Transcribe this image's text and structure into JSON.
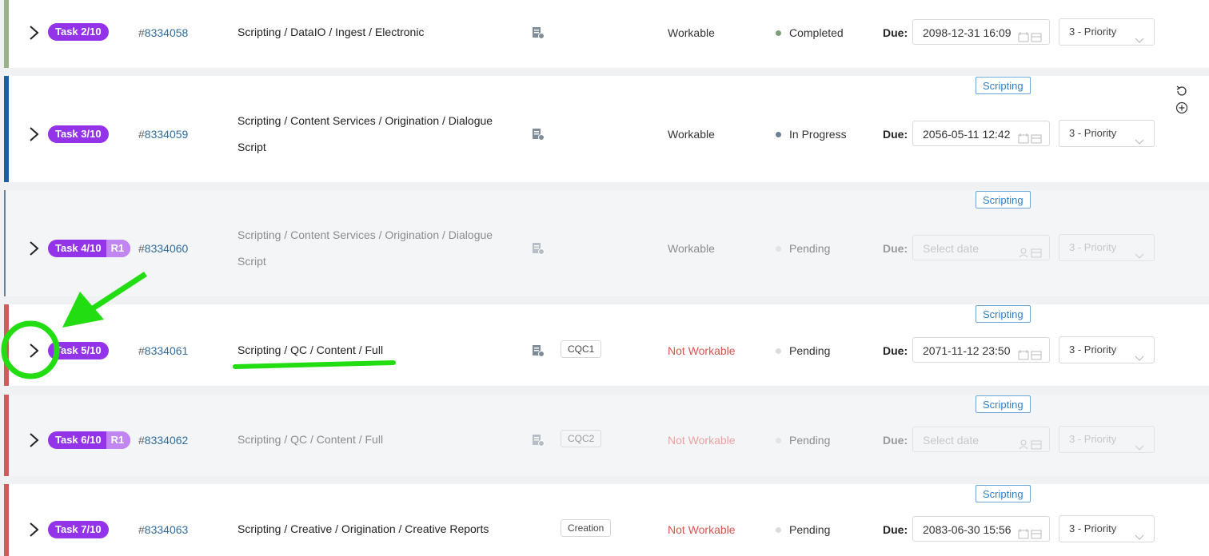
{
  "due_label": "Due:",
  "tag_label": "Scripting",
  "rows": [
    {
      "task": "Task 2/10",
      "r1": "",
      "hash": "#",
      "id": "8334058",
      "path": "Scripting / DataIO / Ingest / Electronic",
      "chip": "",
      "status": "Workable",
      "progress": "Completed",
      "due": "2098-12-31 16:09",
      "priority": "3 - Priority",
      "bar_color": "#9bb38a",
      "dot_color": "#7aa07a"
    },
    {
      "task": "Task 3/10",
      "r1": "",
      "hash": "#",
      "id": "8334059",
      "path": "Scripting / Content Services / Origination / Dialogue Script",
      "chip": "",
      "status": "Workable",
      "progress": "In Progress",
      "due": "2056-05-11 12:42",
      "priority": "3 - Priority",
      "bar_color": "#1d5fa3",
      "dot_color": "#6b7f95"
    },
    {
      "task": "Task 4/10",
      "r1": "R1",
      "hash": "#",
      "id": "8334060",
      "path": "Scripting / Content Services / Origination / Dialogue Script",
      "chip": "",
      "status": "Workable",
      "progress": "Pending",
      "due": "Select date",
      "priority": "3 - Priority",
      "bar_color": "#6b7f95",
      "dot_color": "#e3e3e3"
    },
    {
      "task": "Task 5/10",
      "r1": "",
      "hash": "#",
      "id": "8334061",
      "path": "Scripting / QC / Content / Full",
      "chip": "CQC1",
      "status": "Not Workable",
      "progress": "Pending",
      "due": "2071-11-12 23:50",
      "priority": "3 - Priority",
      "bar_color": "#cd5c5c",
      "dot_color": "#dcdcdc"
    },
    {
      "task": "Task 6/10",
      "r1": "R1",
      "hash": "#",
      "id": "8334062",
      "path": "Scripting / QC / Content / Full",
      "chip": "CQC2",
      "status": "Not Workable",
      "progress": "Pending",
      "due": "Select date",
      "priority": "3 - Priority",
      "bar_color": "#cd5c5c",
      "dot_color": "#e3e3e3"
    },
    {
      "task": "Task 7/10",
      "r1": "",
      "hash": "#",
      "id": "8334063",
      "path": "Scripting / Creative / Origination / Creative Reports",
      "chip": "Creation",
      "status": "Not Workable",
      "progress": "Pending",
      "due": "2083-06-30 15:56",
      "priority": "3 - Priority",
      "bar_color": "#cd5c5c",
      "dot_color": "#dcdcdc"
    }
  ],
  "icons": {
    "expand": "chevron-right-icon",
    "document": "document-info-icon",
    "calendar": "calendar-icon",
    "user_calendar": "user-calendar-icon",
    "dropdown": "chevron-down-icon",
    "refresh": "refresh-icon",
    "add": "add-circle-icon"
  },
  "annotation": {
    "color": "#22dd11",
    "shapes": [
      "circle around row 5 expand chevron",
      "arrow pointing to circle",
      "underline under row 5 path"
    ]
  }
}
